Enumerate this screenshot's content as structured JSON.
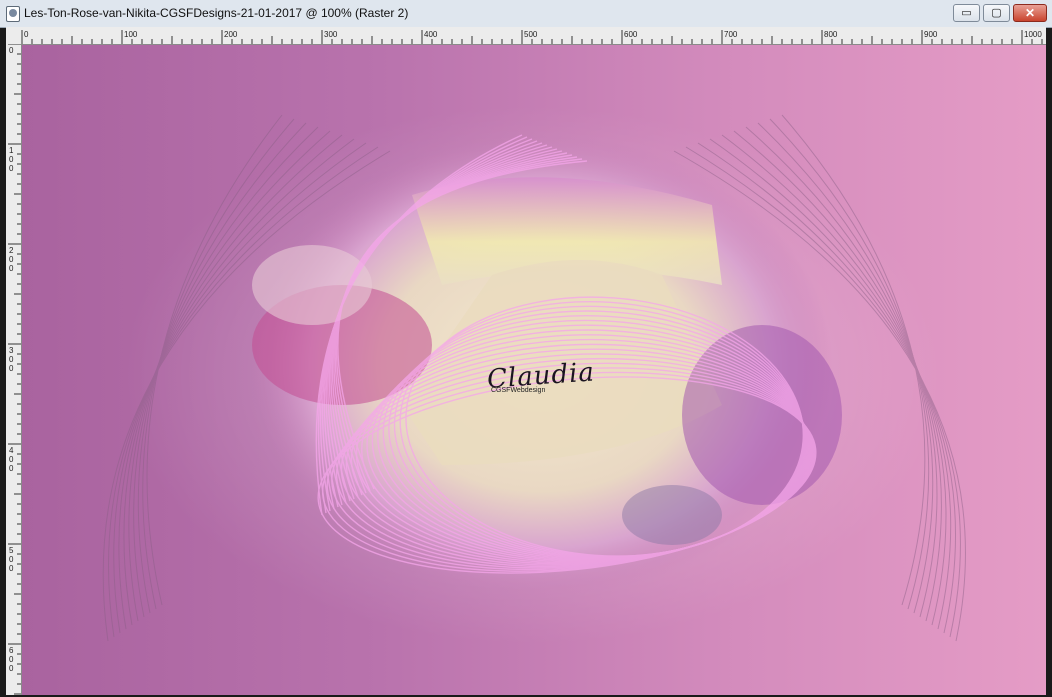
{
  "window": {
    "title": "Les-Ton-Rose-van-Nikita-CGSFDesigns-21-01-2017 @ 100% (Raster 2)",
    "controls": {
      "minimize": "▭",
      "maximize": "▢",
      "close": "✕"
    }
  },
  "ruler": {
    "top_labels": [
      "0",
      "100",
      "200",
      "300",
      "400",
      "500",
      "600",
      "700",
      "800",
      "900",
      "1000"
    ],
    "left_labels": [
      "0",
      "100",
      "200",
      "300",
      "400",
      "500",
      "600"
    ]
  },
  "canvas": {
    "signature": "Claudia",
    "signature_sub": "CGSFWebdesign",
    "colors": {
      "bg_left": "#a9639f",
      "bg_right": "#e59cc6",
      "path": "#efe4c4",
      "lines": "#f3a8e8"
    }
  }
}
